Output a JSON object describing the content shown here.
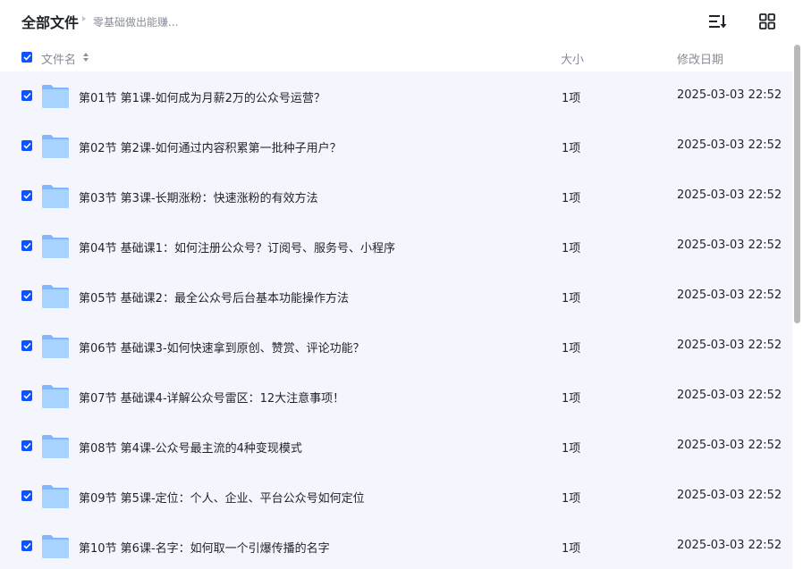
{
  "header": {
    "title": "全部文件",
    "subpath": "零基础做出能赚..."
  },
  "columns": {
    "name": "文件名",
    "size": "大小",
    "date": "修改日期"
  },
  "colors": {
    "accent": "#0d53ff",
    "row_selected_bg": "#f5f6fd",
    "folder_color": "#8ec5ff"
  },
  "rows": [
    {
      "name": "第01节 第1课-如何成为月薪2万的公众号运营？",
      "size": "1项",
      "date": "2025-03-03 22:52",
      "checked": true
    },
    {
      "name": "第02节 第2课-如何通过内容积累第一批种子用户？",
      "size": "1项",
      "date": "2025-03-03 22:52",
      "checked": true
    },
    {
      "name": "第03节 第3课-长期涨粉：快速涨粉的有效方法",
      "size": "1项",
      "date": "2025-03-03 22:52",
      "checked": true
    },
    {
      "name": "第04节 基础课1：如何注册公众号？订阅号、服务号、小程序",
      "size": "1项",
      "date": "2025-03-03 22:52",
      "checked": true
    },
    {
      "name": "第05节 基础课2：最全公众号后台基本功能操作方法",
      "size": "1项",
      "date": "2025-03-03 22:52",
      "checked": true
    },
    {
      "name": "第06节 基础课3-如何快速拿到原创、赞赏、评论功能？",
      "size": "1项",
      "date": "2025-03-03 22:52",
      "checked": true
    },
    {
      "name": "第07节 基础课4-详解公众号雷区：12大注意事项！",
      "size": "1项",
      "date": "2025-03-03 22:52",
      "checked": true
    },
    {
      "name": "第08节 第4课-公众号最主流的4种变现模式",
      "size": "1项",
      "date": "2025-03-03 22:52",
      "checked": true
    },
    {
      "name": "第09节 第5课-定位：个人、企业、平台公众号如何定位",
      "size": "1项",
      "date": "2025-03-03 22:52",
      "checked": true
    },
    {
      "name": "第10节 第6课-名字：如何取一个引爆传播的名字",
      "size": "1项",
      "date": "2025-03-03 22:52",
      "checked": true
    }
  ]
}
